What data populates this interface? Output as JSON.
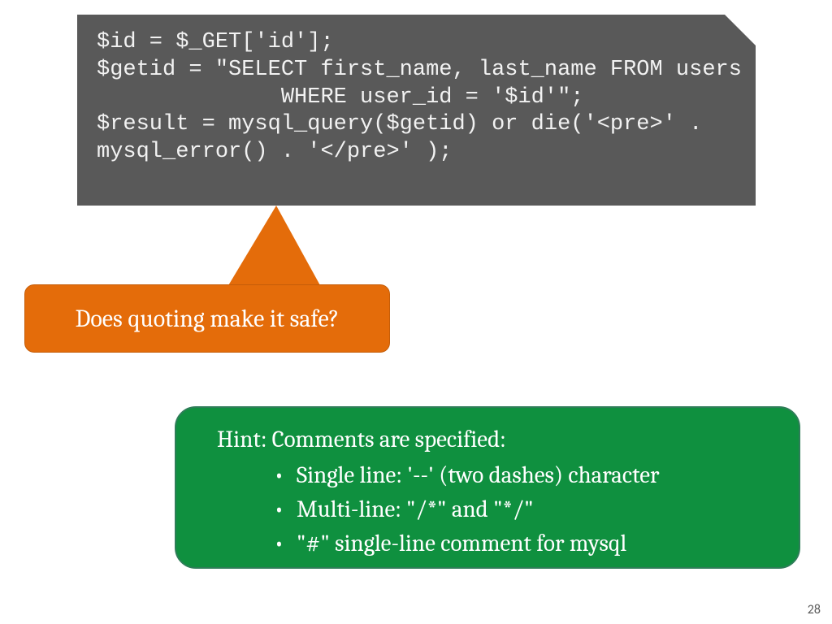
{
  "code": {
    "line1": "$id = $_GET['id'];",
    "line2": "$getid = \"SELECT first_name, last_name FROM users",
    "line3": "              WHERE user_id = '$id'\";",
    "line4": "$result = mysql_query($getid) or die('<pre>' . ",
    "line5": "mysql_error() . '</pre>' );"
  },
  "callout": {
    "text": "Does quoting make it safe?"
  },
  "hint": {
    "title": "Hint: Comments are specified:",
    "items": [
      "Single line: '--' (two dashes) character",
      "Multi-line: \"/*\" and \"*/\"",
      "\"#\" single-line comment for mysql"
    ]
  },
  "page_number": "28",
  "colors": {
    "code_bg": "#595959",
    "code_fg": "#f2f2f2",
    "callout_bg": "#e46c0a",
    "hint_bg": "#0f903f"
  }
}
